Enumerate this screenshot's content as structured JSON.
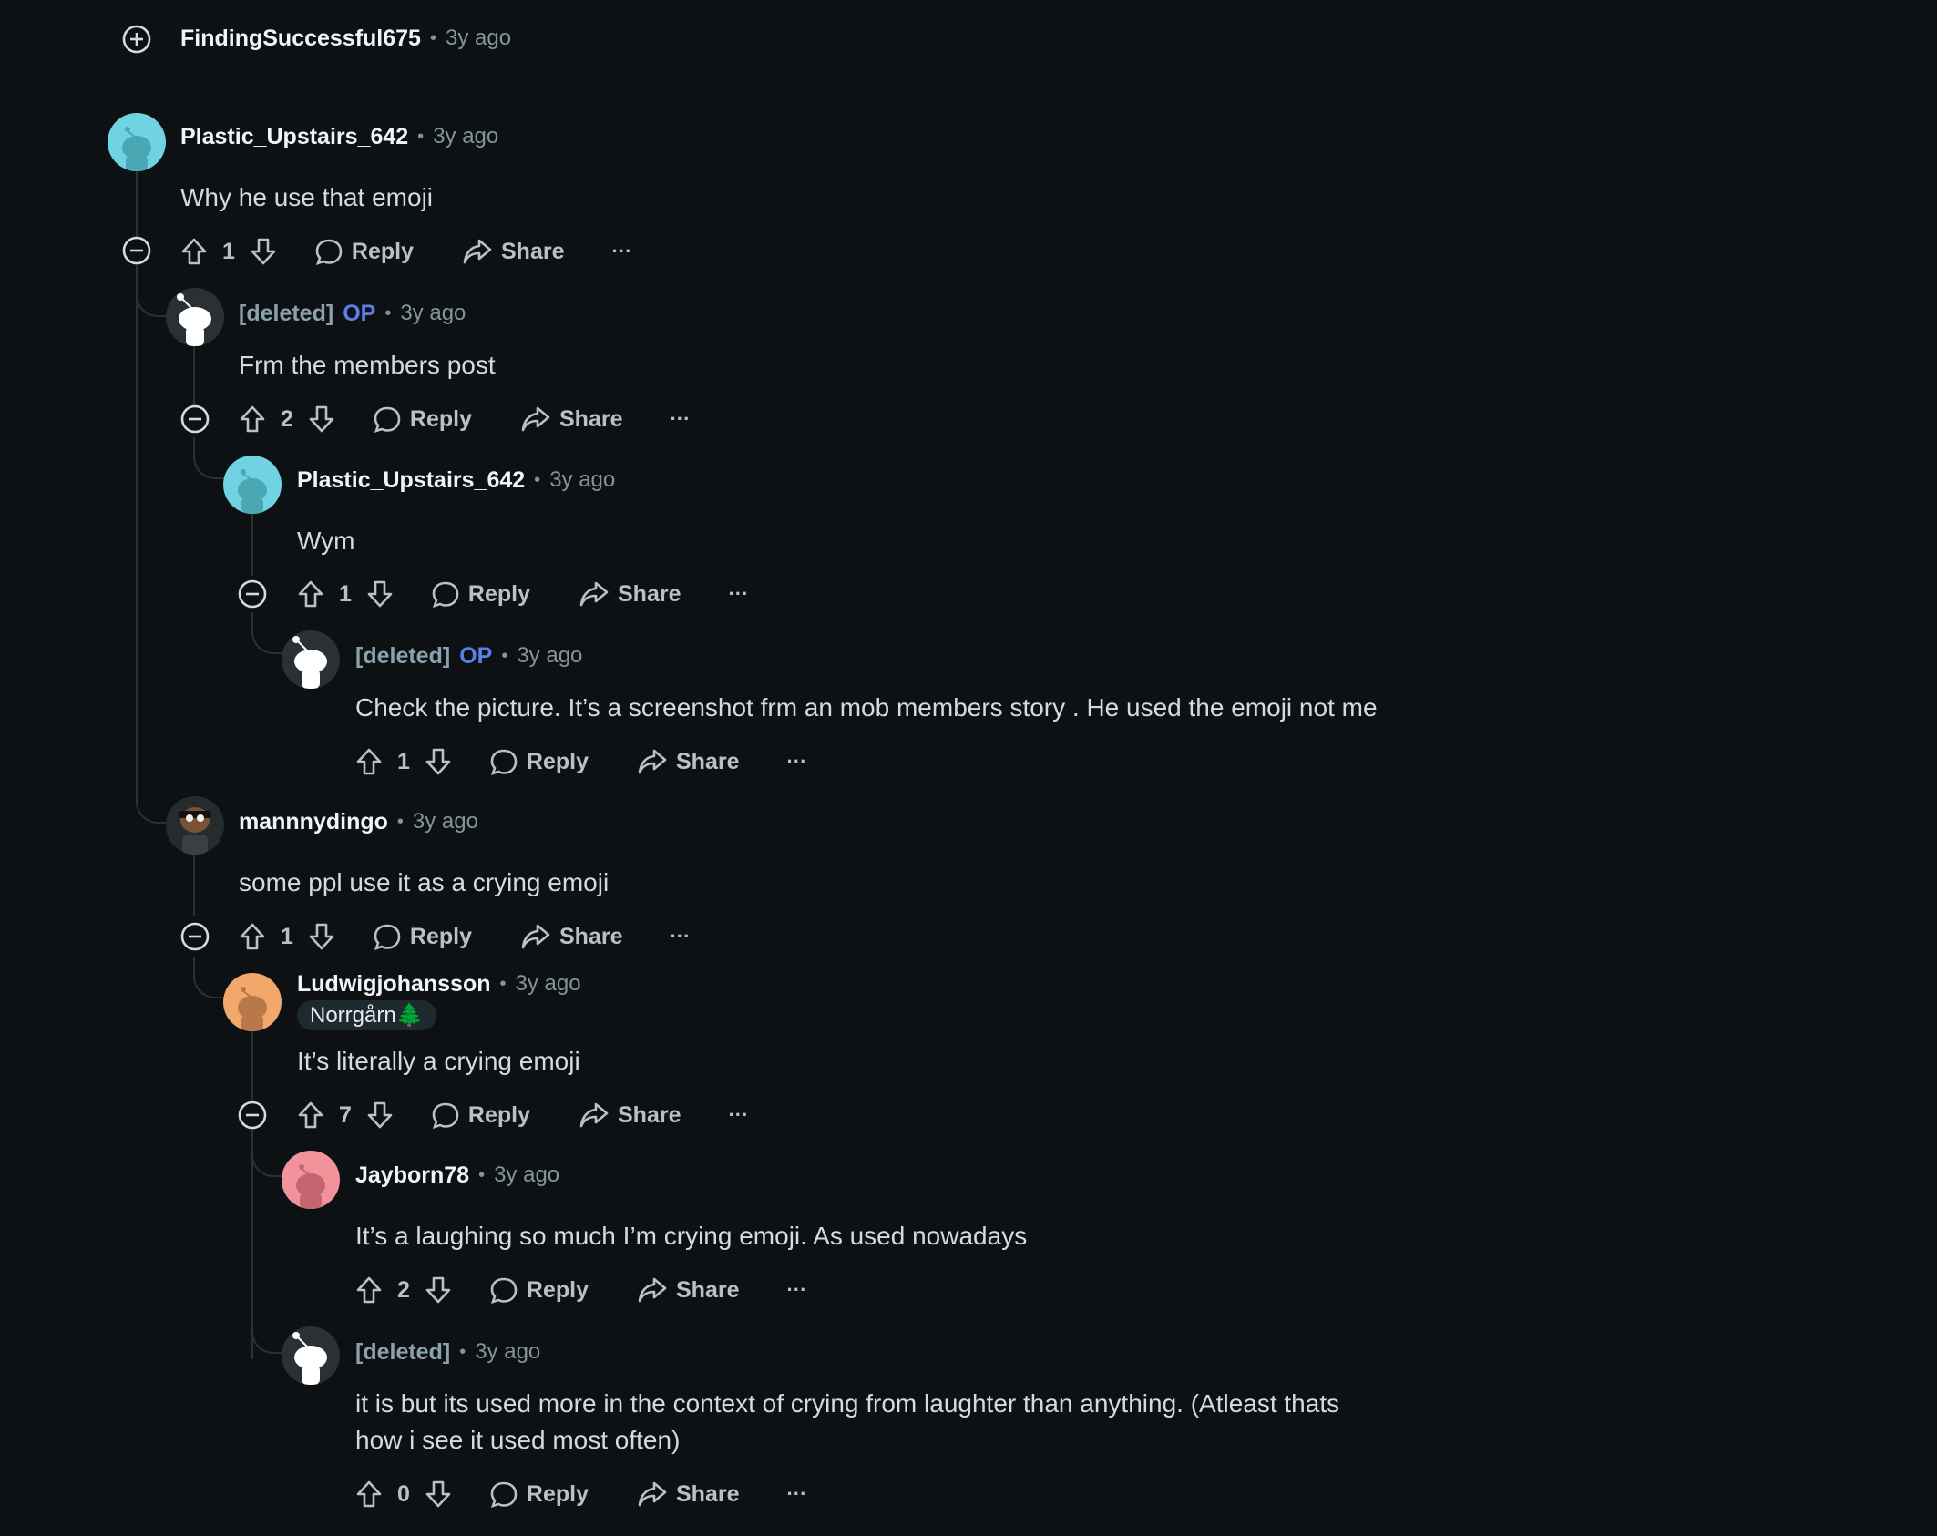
{
  "top_comment": {
    "username": "FindingSuccessful675",
    "time": "3y ago"
  },
  "comments": [
    {
      "username": "Plastic_Upstairs_642",
      "op": false,
      "time": "3y ago",
      "body": "Why he use that emoji",
      "votes": "1",
      "avatar_color": "#6fd3e2"
    },
    {
      "username": "[deleted]",
      "op": true,
      "op_label": "OP",
      "time": "3y ago",
      "body": "Frm the members post",
      "votes": "2"
    },
    {
      "username": "Plastic_Upstairs_642",
      "op": false,
      "time": "3y ago",
      "body": "Wym",
      "votes": "1",
      "avatar_color": "#6fd3e2"
    },
    {
      "username": "[deleted]",
      "op": true,
      "op_label": "OP",
      "time": "3y ago",
      "body": "Check the picture. It’s a screenshot frm an mob members story . He used the emoji not me",
      "votes": "1"
    },
    {
      "username": "mannnydingo",
      "op": false,
      "time": "3y ago",
      "body": "some ppl use it as a crying emoji",
      "votes": "1"
    },
    {
      "username": "Ludwigjohansson",
      "op": false,
      "time": "3y ago",
      "flair": "Norrgårn🌲",
      "body": "It’s literally a crying emoji",
      "votes": "7",
      "avatar_color": "#f2a86b"
    },
    {
      "username": "Jayborn78",
      "op": false,
      "time": "3y ago",
      "body": "It’s a laughing so much I’m crying emoji. As used nowadays",
      "votes": "2",
      "avatar_color": "#f2939b"
    },
    {
      "username": "[deleted]",
      "op": false,
      "time": "3y ago",
      "body_line1": "it is but its used more in the context of crying from laughter than anything. (Atleast thats",
      "body_line2": "how i see it used most often)",
      "votes": "0"
    }
  ],
  "labels": {
    "reply": "Reply",
    "share": "Share",
    "more": "···",
    "dot": "•"
  }
}
